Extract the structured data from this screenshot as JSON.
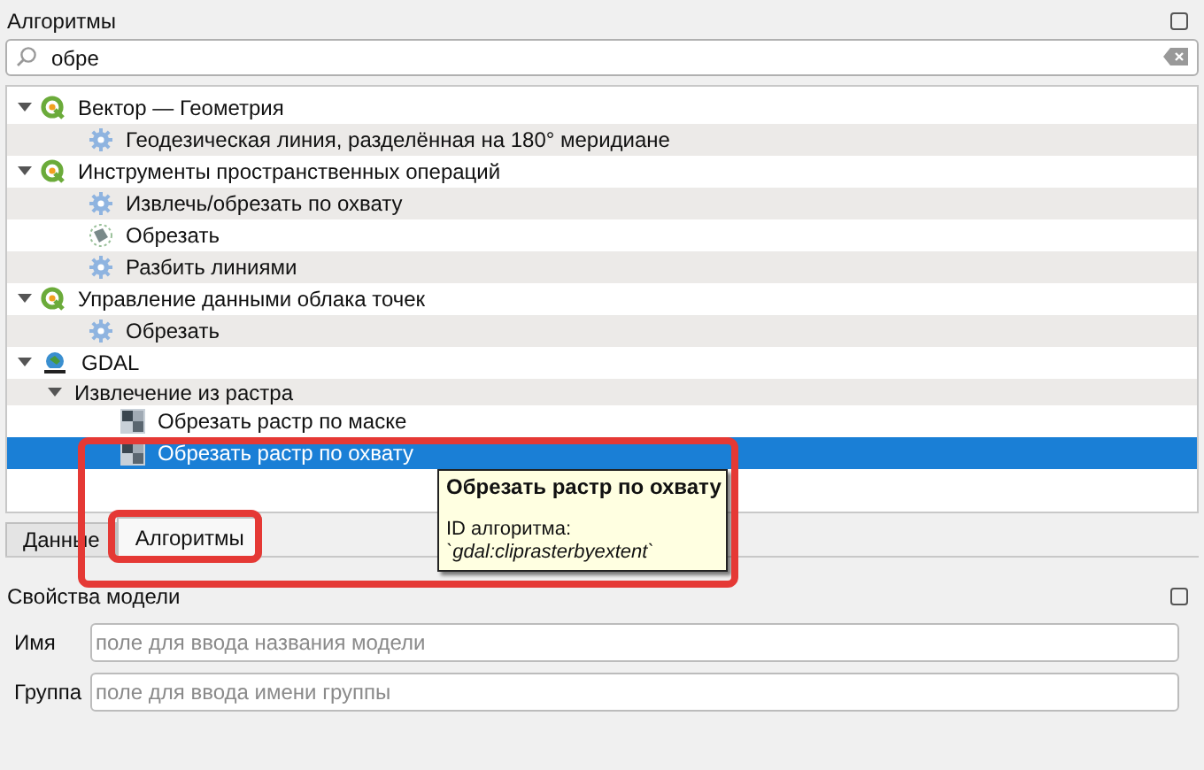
{
  "panel": {
    "title": "Алгоритмы"
  },
  "search": {
    "value": "обре"
  },
  "tree": [
    {
      "kind": "qgis",
      "label": "Вектор — Геометрия",
      "expanded": true,
      "selected": false,
      "children": [
        {
          "kind": "gear",
          "label": "Геодезическая линия, разделённая на 180° меридиане",
          "selected": false
        }
      ]
    },
    {
      "kind": "qgis",
      "label": "Инструменты пространственных операций",
      "expanded": true,
      "selected": false,
      "children": [
        {
          "kind": "gear",
          "label": "Извлечь/обрезать по охвату",
          "selected": false
        },
        {
          "kind": "clip",
          "label": "Обрезать",
          "selected": false
        },
        {
          "kind": "gear",
          "label": "Разбить линиями",
          "selected": false
        }
      ]
    },
    {
      "kind": "qgis",
      "label": "Управление данными облака точек",
      "expanded": true,
      "selected": false,
      "children": [
        {
          "kind": "gear",
          "label": "Обрезать",
          "selected": false
        }
      ]
    },
    {
      "kind": "gdal",
      "label": "GDAL",
      "expanded": true,
      "selected": false,
      "children": [
        {
          "kind": "folder",
          "label": "Извлечение из растра",
          "expanded": true,
          "selected": false,
          "children": [
            {
              "kind": "raster",
              "label": "Обрезать растр по маске",
              "selected": false
            },
            {
              "kind": "raster",
              "label": "Обрезать растр по охвату",
              "selected": true
            }
          ]
        }
      ]
    }
  ],
  "tooltip": {
    "title": "Обрезать растр по охвату",
    "id_label": "ID алгоритма:",
    "id_value": "`gdal:cliprasterbyextent`"
  },
  "tabs": [
    {
      "label": "Данные",
      "selected": false
    },
    {
      "label": "Алгоритмы",
      "selected": true
    }
  ],
  "properties": {
    "title": "Свойства модели",
    "fields": [
      {
        "label": "Имя",
        "placeholder": "поле для ввода названия модели"
      },
      {
        "label": "Группа",
        "placeholder": "поле для ввода имени группы"
      }
    ]
  }
}
